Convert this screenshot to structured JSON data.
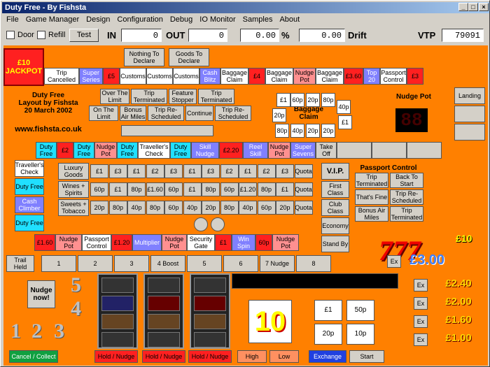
{
  "window": {
    "title": "Duty Free - By Fishsta"
  },
  "menu": [
    "File",
    "Game Manager",
    "Design",
    "Configuration",
    "Debug",
    "IO Monitor",
    "Samples",
    "About"
  ],
  "toolbar": {
    "door": "Door",
    "refill": "Refill",
    "test": "Test",
    "in_label": "IN",
    "in_value": "0",
    "out_label": "OUT",
    "out_value": "0",
    "pct_value": "0.00",
    "pct_label": "%",
    "drift_value": "0.00",
    "drift_label": "Drift",
    "vtp_label": "VTP",
    "vtp_value": "79091"
  },
  "jackpot": "£10 JACKPOT",
  "top_row": [
    "Trip Cancelled",
    "Super Series",
    "£5",
    "Customs",
    "Customs",
    "Customs",
    "Cash Blitz",
    "Baggage Claim",
    "£4",
    "Baggage Claim",
    "Nudge Pot",
    "Baggage Claim",
    "£3.60",
    "Top 20",
    "Passport Control",
    "£3"
  ],
  "declare": [
    "Nothing To Declare",
    "Goods To Declare"
  ],
  "title_block": {
    "l1": "Duty Free",
    "l2": "Layout by Fishsta",
    "l3": "20 March 2002",
    "url": "www.fishsta.co.uk"
  },
  "trip_grid": [
    "Over The Limit",
    "Trip Terminated",
    "Feature Stopper",
    "Trip Terminated",
    "On The Limit",
    "Bonus Air Miles",
    "Trip Re-Scheduled",
    "Continue",
    "Trip Re-Scheduled"
  ],
  "baggage": {
    "title": "Baggage Claim",
    "cells": [
      "£1",
      "60p",
      "20p",
      "80p",
      "20p",
      "40p",
      "£1",
      "80p",
      "40p",
      "20p",
      "20p"
    ]
  },
  "nudge_pot": {
    "title": "Nudge Pot",
    "digits": "88"
  },
  "landing": "Landing",
  "trail": [
    "Duty Free",
    "£2",
    "Duty Free",
    "Nudge Pot",
    "Duty Free",
    "Traveller's Check",
    "Duty Free",
    "Skill Nudge",
    "£2.20",
    "Reel Skill",
    "Nudge Pot",
    "Super Sevens",
    "Take Off"
  ],
  "left_col": [
    "Traveller's Check",
    "Duty Free",
    "Cash Climber",
    "Duty Free"
  ],
  "shop": {
    "rows": [
      {
        "label": "Luxury Goods",
        "vals": [
          "£1",
          "£3",
          "£1",
          "£2",
          "£3",
          "£1",
          "£3",
          "£2",
          "£1",
          "£2",
          "£3",
          "Quota"
        ]
      },
      {
        "label": "Wines + Spirits",
        "vals": [
          "60p",
          "£1",
          "80p",
          "£1.60",
          "60p",
          "£1",
          "80p",
          "60p",
          "£1.20",
          "80p",
          "£1",
          "Quota"
        ]
      },
      {
        "label": "Sweets + Tobacco",
        "vals": [
          "20p",
          "80p",
          "40p",
          "80p",
          "60p",
          "40p",
          "20p",
          "80p",
          "40p",
          "60p",
          "20p",
          "Quota"
        ]
      }
    ]
  },
  "vip": {
    "title": "V.I.P.",
    "items": [
      "First Class",
      "Club Class",
      "Economy",
      "Stand By"
    ]
  },
  "passport": {
    "title": "Passport Control",
    "items": [
      "Trip Terminated",
      "Back To Start",
      "That's Fine",
      "Trip Re-Scheduled",
      "Bonus Air Miles",
      "Trip Terminated"
    ]
  },
  "bottom_trail": [
    "£1.60",
    "Nudge Pot",
    "Passport Control",
    "£1.20",
    "Multiplier",
    "Nudge Pot",
    "Security Gate",
    "£1",
    "Win Spin",
    "60p",
    "Nudge Pot"
  ],
  "numbers": {
    "trail_held": "Trail Held",
    "cells": [
      "1",
      "2",
      "3",
      "4 Boost",
      "5",
      "6",
      "7 Nudge",
      "8"
    ]
  },
  "nudge_btn": "Nudge now!",
  "nudge_digits": [
    "5",
    "4",
    "1",
    "2",
    "3"
  ],
  "ten": "10",
  "coins": [
    "£1",
    "50p",
    "20p",
    "10p"
  ],
  "ex": "Ex",
  "prizes": [
    "£10",
    "£3.00",
    "£2.40",
    "£2.00",
    "£1.60",
    "£1.00"
  ],
  "buttons": {
    "cancel": "Cancel / Collect",
    "hold1": "Hold / Nudge",
    "hold2": "Hold / Nudge",
    "hold3": "Hold / Nudge",
    "high": "High",
    "low": "Low",
    "exchange": "Exchange",
    "start": "Start"
  },
  "colors": {
    "orange": "#ff8000",
    "title_blue": "#0a246a",
    "red": "#ff2020",
    "gold": "#ffd700"
  }
}
